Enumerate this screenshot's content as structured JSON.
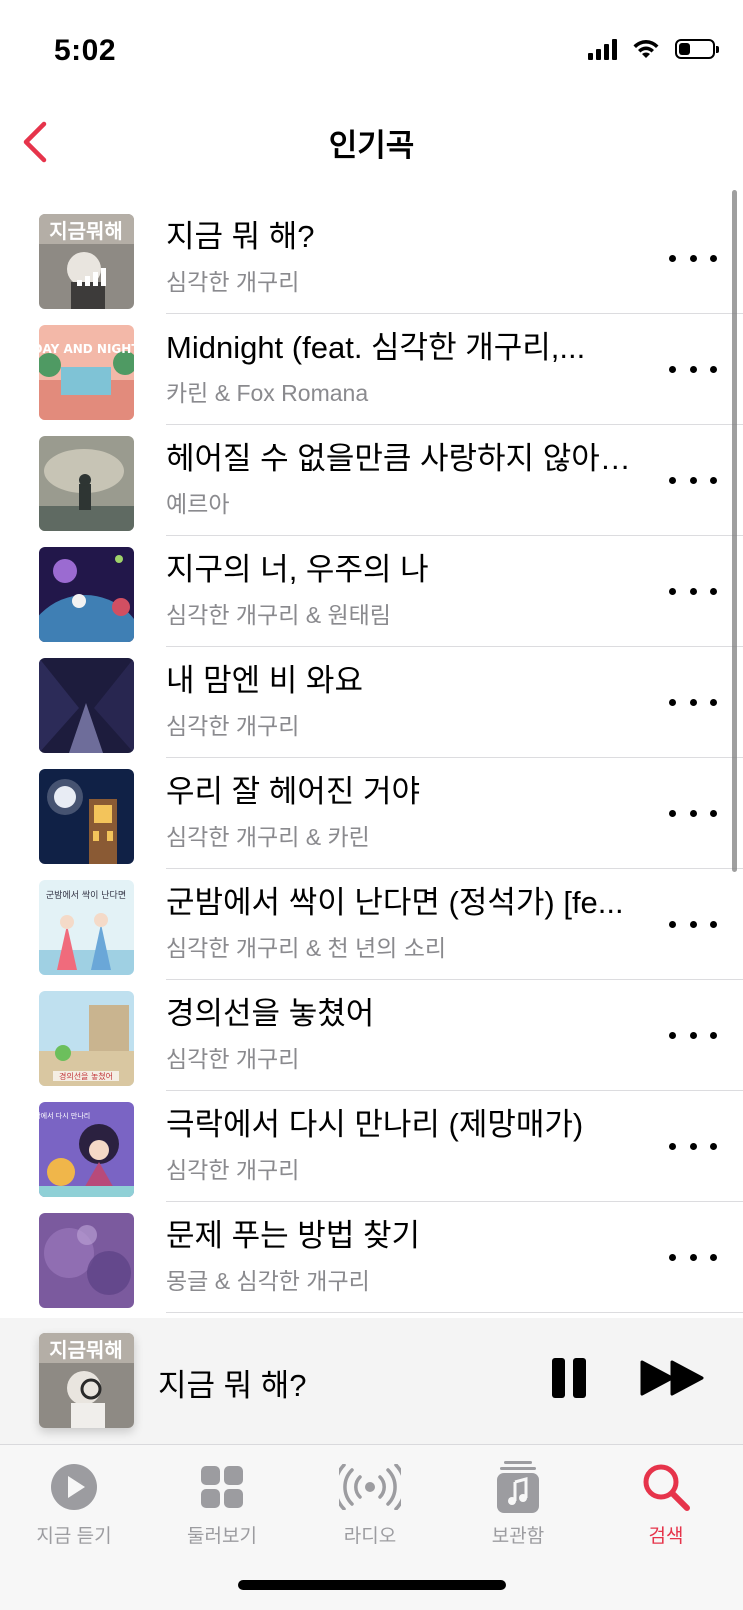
{
  "status": {
    "time": "5:02",
    "battery_level": 0.35
  },
  "nav": {
    "title": "인기곡"
  },
  "songs": [
    {
      "title": "지금 뭐 해?",
      "artist": "심각한 개구리",
      "art_text": "지금뭐해",
      "now_playing": true
    },
    {
      "title": "Midnight (feat. 심각한 개구리,...",
      "artist": "카린 & Fox Romana",
      "art_text": "DAY AND NIGHT"
    },
    {
      "title": "헤어질 수 없을만큼 사랑하지 않아…",
      "artist": "예르아"
    },
    {
      "title": "지구의 너, 우주의 나",
      "artist": "심각한 개구리 & 원태림"
    },
    {
      "title": "내 맘엔 비 와요",
      "artist": "심각한 개구리"
    },
    {
      "title": "우리 잘 헤어진 거야",
      "artist": "심각한 개구리 & 카린"
    },
    {
      "title": "군밤에서 싹이 난다면 (정석가) [fe...",
      "artist": "심각한 개구리 & 천 년의 소리",
      "art_text": "군밤에서 싹이 난다면"
    },
    {
      "title": "경의선을 놓쳤어",
      "artist": "심각한 개구리",
      "art_text": "경의선을 놓쳤어"
    },
    {
      "title": "극락에서 다시 만나리 (제망매가)",
      "artist": "심각한 개구리",
      "art_text": "극락에서 다시 만나리"
    },
    {
      "title": "문제 푸는 방법 찾기",
      "artist": "몽글 & 심각한 개구리"
    }
  ],
  "player": {
    "title": "지금 뭐 해?",
    "art_text": "지금뭐해"
  },
  "tabs": [
    {
      "label": "지금 듣기",
      "icon": "play-circle-icon"
    },
    {
      "label": "둘러보기",
      "icon": "grid-icon"
    },
    {
      "label": "라디오",
      "icon": "radio-icon"
    },
    {
      "label": "보관함",
      "icon": "library-icon"
    },
    {
      "label": "검색",
      "icon": "search-icon",
      "active": true
    }
  ],
  "colors": {
    "accent": "#e6344b",
    "secondary_text": "#8a8a8e",
    "divider": "#dcdcdf",
    "player_bg": "#f4f4f4"
  }
}
